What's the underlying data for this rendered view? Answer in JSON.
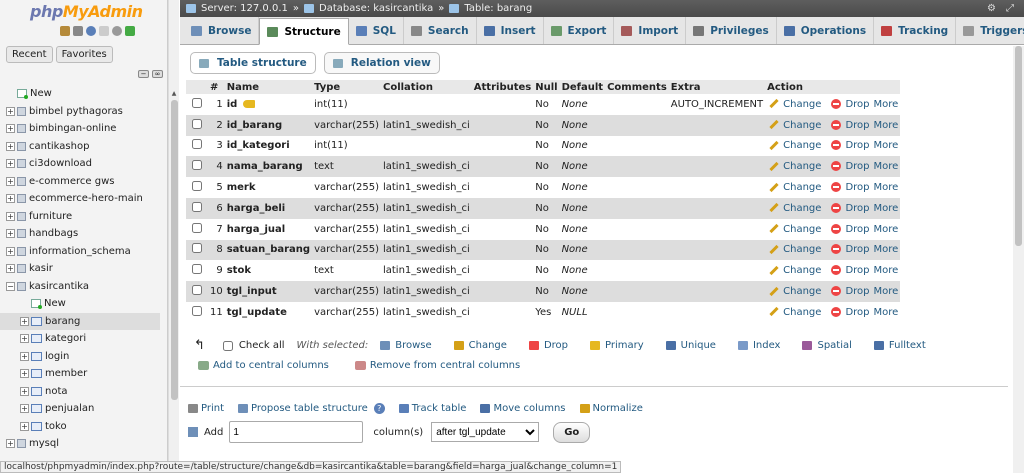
{
  "logo": {
    "php": "php",
    "my": "MyAdmin"
  },
  "nav": {
    "recent": "Recent",
    "favorites": "Favorites"
  },
  "tree": [
    {
      "label": "New",
      "type": "new",
      "indent": 0
    },
    {
      "label": "bimbel pythagoras",
      "type": "db",
      "indent": 0
    },
    {
      "label": "bimbingan-online",
      "type": "db",
      "indent": 0
    },
    {
      "label": "cantikashop",
      "type": "db",
      "indent": 0
    },
    {
      "label": "ci3download",
      "type": "db",
      "indent": 0
    },
    {
      "label": "e-commerce gws",
      "type": "db",
      "indent": 0
    },
    {
      "label": "ecommerce-hero-main",
      "type": "db",
      "indent": 0
    },
    {
      "label": "furniture",
      "type": "db",
      "indent": 0
    },
    {
      "label": "handbags",
      "type": "db",
      "indent": 0
    },
    {
      "label": "information_schema",
      "type": "db",
      "indent": 0
    },
    {
      "label": "kasir",
      "type": "db",
      "indent": 0
    },
    {
      "label": "kasircantika",
      "type": "db-open",
      "indent": 0
    },
    {
      "label": "New",
      "type": "new",
      "indent": 1
    },
    {
      "label": "barang",
      "type": "table",
      "indent": 1,
      "selected": true
    },
    {
      "label": "kategori",
      "type": "table",
      "indent": 1
    },
    {
      "label": "login",
      "type": "table",
      "indent": 1
    },
    {
      "label": "member",
      "type": "table",
      "indent": 1
    },
    {
      "label": "nota",
      "type": "table",
      "indent": 1
    },
    {
      "label": "penjualan",
      "type": "table",
      "indent": 1
    },
    {
      "label": "toko",
      "type": "table",
      "indent": 1
    },
    {
      "label": "mysql",
      "type": "db",
      "indent": 0
    }
  ],
  "breadcrumb": {
    "server": "Server: 127.0.0.1",
    "sep1": "»",
    "database": "Database: kasircantika",
    "sep2": "»",
    "table": "Table: barang"
  },
  "tabs": [
    {
      "label": "Browse",
      "color": "#6e8fb8"
    },
    {
      "label": "Structure",
      "color": "#5a8a5a",
      "active": true
    },
    {
      "label": "SQL",
      "color": "#5a7fb8"
    },
    {
      "label": "Search",
      "color": "#888"
    },
    {
      "label": "Insert",
      "color": "#4a6fa5"
    },
    {
      "label": "Export",
      "color": "#6a9a6a"
    },
    {
      "label": "Import",
      "color": "#a55a5a"
    },
    {
      "label": "Privileges",
      "color": "#777"
    },
    {
      "label": "Operations",
      "color": "#4a6fa5"
    },
    {
      "label": "Tracking",
      "color": "#c04040"
    },
    {
      "label": "Triggers",
      "color": "#999"
    }
  ],
  "subtabs": [
    {
      "label": "Table structure",
      "active": true
    },
    {
      "label": "Relation view"
    }
  ],
  "columns": [
    "#",
    "Name",
    "Type",
    "Collation",
    "Attributes",
    "Null",
    "Default",
    "Comments",
    "Extra",
    "Action"
  ],
  "rows": [
    {
      "n": "1",
      "name": "id",
      "key": true,
      "type": "int(11)",
      "collation": "",
      "null": "No",
      "default": "None",
      "extra": "AUTO_INCREMENT"
    },
    {
      "n": "2",
      "name": "id_barang",
      "type": "varchar(255)",
      "collation": "latin1_swedish_ci",
      "null": "No",
      "default": "None",
      "extra": ""
    },
    {
      "n": "3",
      "name": "id_kategori",
      "type": "int(11)",
      "collation": "",
      "null": "No",
      "default": "None",
      "extra": ""
    },
    {
      "n": "4",
      "name": "nama_barang",
      "type": "text",
      "collation": "latin1_swedish_ci",
      "null": "No",
      "default": "None",
      "extra": ""
    },
    {
      "n": "5",
      "name": "merk",
      "type": "varchar(255)",
      "collation": "latin1_swedish_ci",
      "null": "No",
      "default": "None",
      "extra": ""
    },
    {
      "n": "6",
      "name": "harga_beli",
      "type": "varchar(255)",
      "collation": "latin1_swedish_ci",
      "null": "No",
      "default": "None",
      "extra": ""
    },
    {
      "n": "7",
      "name": "harga_jual",
      "type": "varchar(255)",
      "collation": "latin1_swedish_ci",
      "null": "No",
      "default": "None",
      "extra": ""
    },
    {
      "n": "8",
      "name": "satuan_barang",
      "type": "varchar(255)",
      "collation": "latin1_swedish_ci",
      "null": "No",
      "default": "None",
      "extra": ""
    },
    {
      "n": "9",
      "name": "stok",
      "type": "text",
      "collation": "latin1_swedish_ci",
      "null": "No",
      "default": "None",
      "extra": ""
    },
    {
      "n": "10",
      "name": "tgl_input",
      "type": "varchar(255)",
      "collation": "latin1_swedish_ci",
      "null": "No",
      "default": "None",
      "extra": ""
    },
    {
      "n": "11",
      "name": "tgl_update",
      "type": "varchar(255)",
      "collation": "latin1_swedish_ci",
      "null": "Yes",
      "default": "NULL",
      "extra": ""
    }
  ],
  "actions": {
    "change": "Change",
    "drop": "Drop",
    "more": "More"
  },
  "withsel": {
    "check_all": "Check all",
    "with_selected": "With selected:",
    "items": [
      {
        "label": "Browse",
        "color": "#6e8fb8"
      },
      {
        "label": "Change",
        "color": "#d4a017"
      },
      {
        "label": "Drop",
        "color": "#e44"
      },
      {
        "label": "Primary",
        "color": "#e6b820"
      },
      {
        "label": "Unique",
        "color": "#4a6fa5"
      },
      {
        "label": "Index",
        "color": "#7a9ac8"
      },
      {
        "label": "Spatial",
        "color": "#9a5a9a"
      },
      {
        "label": "Fulltext",
        "color": "#4a6fa5"
      }
    ]
  },
  "central": {
    "add": "Add to central columns",
    "remove": "Remove from central columns"
  },
  "links": [
    "Print",
    "Propose table structure",
    "Track table",
    "Move columns",
    "Normalize"
  ],
  "add": {
    "label": "Add",
    "value": "1",
    "columns": "column(s)",
    "after": "after tgl_update",
    "go": "Go"
  },
  "status": "localhost/phpmyadmin/index.php?route=/table/structure/change&db=kasircantika&table=barang&field=harga_jual&change_column=1"
}
